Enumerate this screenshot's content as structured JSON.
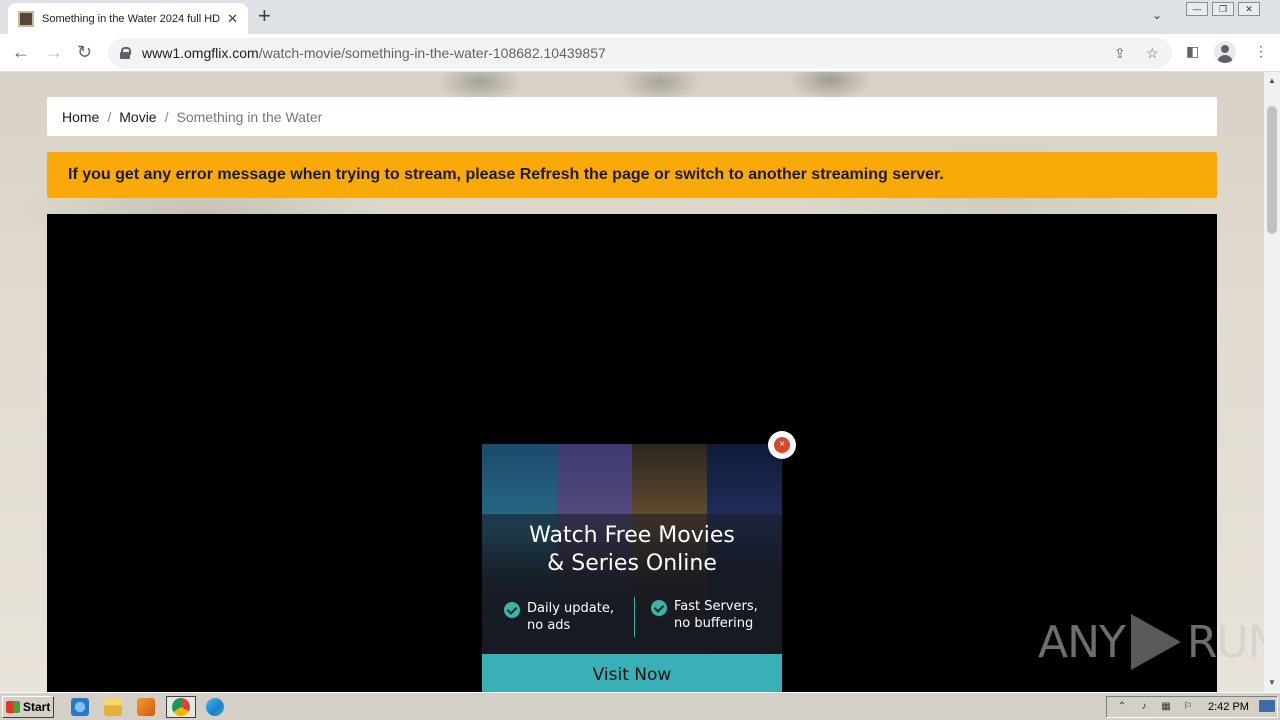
{
  "browser": {
    "tab_title": "Something in the Water 2024 full HD",
    "tab_close": "✕",
    "new_tab": "+",
    "tab_search": "⌄",
    "window_controls": [
      "—",
      "❐",
      "✕"
    ],
    "back": "←",
    "forward": "→",
    "reload": "↻",
    "url_host": "www1.omgflix.com",
    "url_path": "/watch-movie/something-in-the-water-108682.10439857",
    "share": "⇪",
    "bookmark": "☆",
    "sidepanel": "◧",
    "menu": "⋮"
  },
  "page": {
    "breadcrumb": {
      "home": "Home",
      "sep1": "/",
      "movie": "Movie",
      "sep2": "/",
      "current": "Something in the Water"
    },
    "alert_text": "If you get any error message when trying to stream, please Refresh the page or switch to another streaming server."
  },
  "ad": {
    "title_line1": "Watch Free Movies",
    "title_line2": "& Series Online",
    "feature1_line1": "Daily update,",
    "feature1_line2": "no ads",
    "feature2_line1": "Fast Servers,",
    "feature2_line2": "no buffering",
    "button": "Visit Now",
    "close": "×"
  },
  "watermark": {
    "left": "ANY",
    "right": "RUN"
  },
  "taskbar": {
    "start": "Start",
    "clock": "2:42 PM"
  }
}
